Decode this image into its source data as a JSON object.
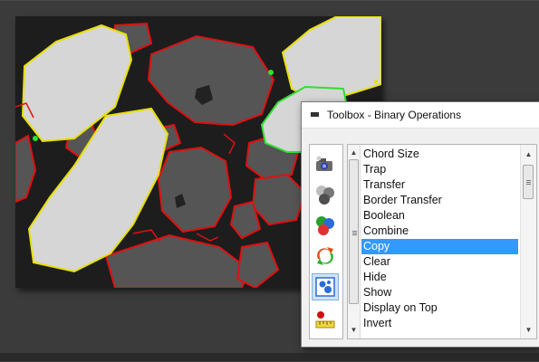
{
  "toolbox": {
    "title": "Toolbox - Binary Operations",
    "operations": [
      "Chord Size",
      "Trap",
      "Transfer",
      "Border Transfer",
      "Boolean",
      "Combine",
      "Copy",
      "Clear",
      "Hide",
      "Show",
      "Display on Top",
      "Invert"
    ],
    "selected_operation": "Copy",
    "tools": [
      {
        "name": "camera-icon"
      },
      {
        "name": "grayscale-spheres-icon"
      },
      {
        "name": "color-spheres-icon"
      },
      {
        "name": "binary-transform-icon",
        "selected": true
      },
      {
        "name": "measure-ruler-icon"
      }
    ]
  },
  "colors": {
    "selection": "#3399ff",
    "outline_red": "#e01010",
    "outline_yellow": "#e8e000",
    "outline_green": "#30e030"
  }
}
